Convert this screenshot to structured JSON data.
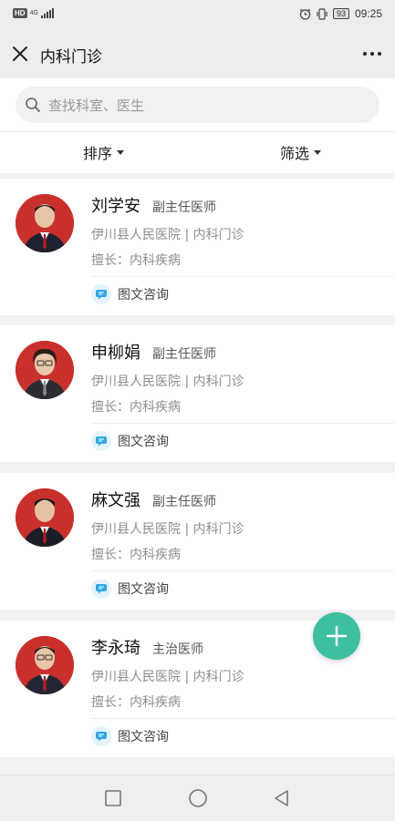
{
  "status_bar": {
    "hd": "HD",
    "network": "4G",
    "battery": "93",
    "time": "09:25"
  },
  "header": {
    "title": "内科门诊",
    "close_icon": "close-icon",
    "more_icon": "more-dots-icon"
  },
  "search": {
    "placeholder": "查找科室、医生"
  },
  "filters": {
    "sort_label": "排序",
    "filter_label": "筛选"
  },
  "doctors": [
    {
      "name": "刘学安",
      "title": "副主任医师",
      "hospital": "伊川县人民医院 | 内科门诊",
      "specialty": "擅长：内科疾病",
      "consult": "图文咨询"
    },
    {
      "name": "申柳娟",
      "title": "副主任医师",
      "hospital": "伊川县人民医院 | 内科门诊",
      "specialty": "擅长：内科疾病",
      "consult": "图文咨询"
    },
    {
      "name": "麻文强",
      "title": "副主任医师",
      "hospital": "伊川县人民医院 | 内科门诊",
      "specialty": "擅长：内科疾病",
      "consult": "图文咨询"
    },
    {
      "name": "李永琦",
      "title": "主治医师",
      "hospital": "伊川县人民医院 | 内科门诊",
      "specialty": "擅长：内科疾病",
      "consult": "图文咨询"
    }
  ],
  "colors": {
    "accent": "#3fbfa2",
    "avatar_bg": "#c9302c",
    "consult_icon": "#2fa7e0"
  }
}
